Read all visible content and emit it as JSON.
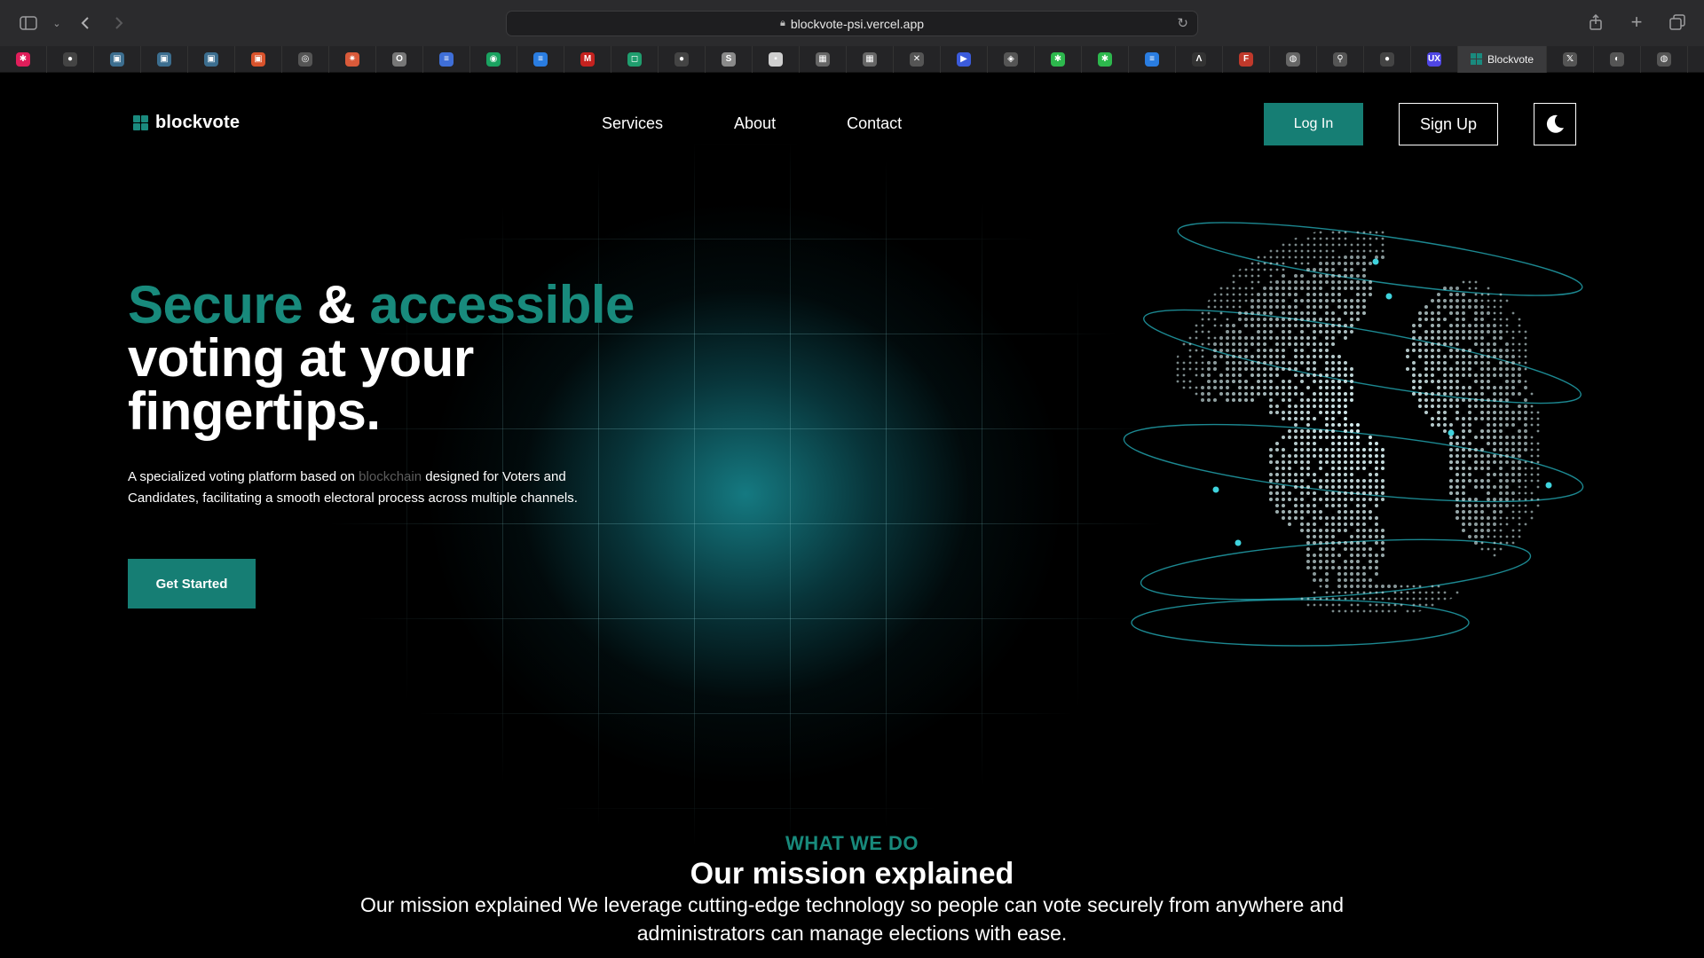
{
  "browser": {
    "url": "blockvote-psi.vercel.app",
    "active_tab": "Blockvote"
  },
  "bookmarks": [
    {
      "icon": "slack-icon",
      "color": "#e01e5a",
      "glyph": "✱"
    },
    {
      "icon": "github-icon",
      "color": "#444444",
      "glyph": "●"
    },
    {
      "icon": "app-icon",
      "color": "#3c6e8f",
      "glyph": "▣"
    },
    {
      "icon": "app-icon",
      "color": "#3c6e8f",
      "glyph": "▣"
    },
    {
      "icon": "app-icon",
      "color": "#3c6e8f",
      "glyph": "▣"
    },
    {
      "icon": "app-icon",
      "color": "#d9532c",
      "glyph": "▣"
    },
    {
      "icon": "openai-icon",
      "color": "#555555",
      "glyph": "◎"
    },
    {
      "icon": "spark-icon",
      "color": "#d95a3a",
      "glyph": "✷"
    },
    {
      "icon": "app-icon",
      "color": "#777777",
      "glyph": "O"
    },
    {
      "icon": "docs-icon",
      "color": "#3f6fd8",
      "glyph": "≡"
    },
    {
      "icon": "app-icon",
      "color": "#1aa260",
      "glyph": "◉"
    },
    {
      "icon": "lines-icon",
      "color": "#2a7de1",
      "glyph": "≡"
    },
    {
      "icon": "gmail-icon",
      "color": "#c5221f",
      "glyph": "M"
    },
    {
      "icon": "app-icon",
      "color": "#1f9e6e",
      "glyph": "◻"
    },
    {
      "icon": "github-icon",
      "color": "#444444",
      "glyph": "●"
    },
    {
      "icon": "app-icon",
      "color": "#8a8a8a",
      "glyph": "S"
    },
    {
      "icon": "app-icon",
      "color": "#cfcfcf",
      "glyph": "▪"
    },
    {
      "icon": "app-icon",
      "color": "#666666",
      "glyph": "▦"
    },
    {
      "icon": "app-icon",
      "color": "#666666",
      "glyph": "▦"
    },
    {
      "icon": "x-icon",
      "color": "#555555",
      "glyph": "✕"
    },
    {
      "icon": "play-icon",
      "color": "#3b5bdb",
      "glyph": "▶"
    },
    {
      "icon": "app-icon",
      "color": "#555555",
      "glyph": "◈"
    },
    {
      "icon": "star-icon",
      "color": "#2db84d",
      "glyph": "✱"
    },
    {
      "icon": "star-icon",
      "color": "#2db84d",
      "glyph": "✱"
    },
    {
      "icon": "lines-icon",
      "color": "#2a7de1",
      "glyph": "≡"
    },
    {
      "icon": "caret-icon",
      "color": "#333333",
      "glyph": "Λ"
    },
    {
      "icon": "app-icon",
      "color": "#c0392b",
      "glyph": "F"
    },
    {
      "icon": "app-icon",
      "color": "#666666",
      "glyph": "◍"
    },
    {
      "icon": "link-icon",
      "color": "#555555",
      "glyph": "⚲"
    },
    {
      "icon": "github-icon",
      "color": "#444444",
      "glyph": "●"
    },
    {
      "icon": "ux-icon",
      "color": "#4f46e5",
      "glyph": "UX"
    }
  ],
  "bookmarks_after_tab": [
    {
      "icon": "x-icon",
      "color": "#555555",
      "glyph": "𝕏"
    },
    {
      "icon": "app-icon",
      "color": "#555555",
      "glyph": "◐"
    },
    {
      "icon": "app-icon",
      "color": "#555555",
      "glyph": "◍"
    }
  ],
  "nav": {
    "logo": "blockvote",
    "links": [
      "Services",
      "About",
      "Contact"
    ],
    "login": "Log In",
    "signup": "Sign Up",
    "theme_icon": "moon-icon"
  },
  "hero": {
    "title_accent1": "Secure",
    "title_amp": "&",
    "title_accent2": "accessible",
    "title_line2": "voting at your",
    "title_line3": "fingertips.",
    "desc_before": "A specialized voting platform based on",
    "desc_highlight": "blockchain",
    "desc_after": "designed for Voters and Candidates, facilitating a smooth electoral process across multiple channels.",
    "cta": "Get Started"
  },
  "mission": {
    "kicker": "WHAT WE DO",
    "title": "Our mission explained",
    "text": "Our mission explained We leverage cutting-edge technology so people can vote securely from anywhere and administrators can manage elections with ease."
  },
  "colors": {
    "accent": "#167e74",
    "accent_text": "#188a7c",
    "background": "#000000",
    "globe_dots": "#d9f1f3",
    "globe_orbits": "#26b6c2"
  }
}
